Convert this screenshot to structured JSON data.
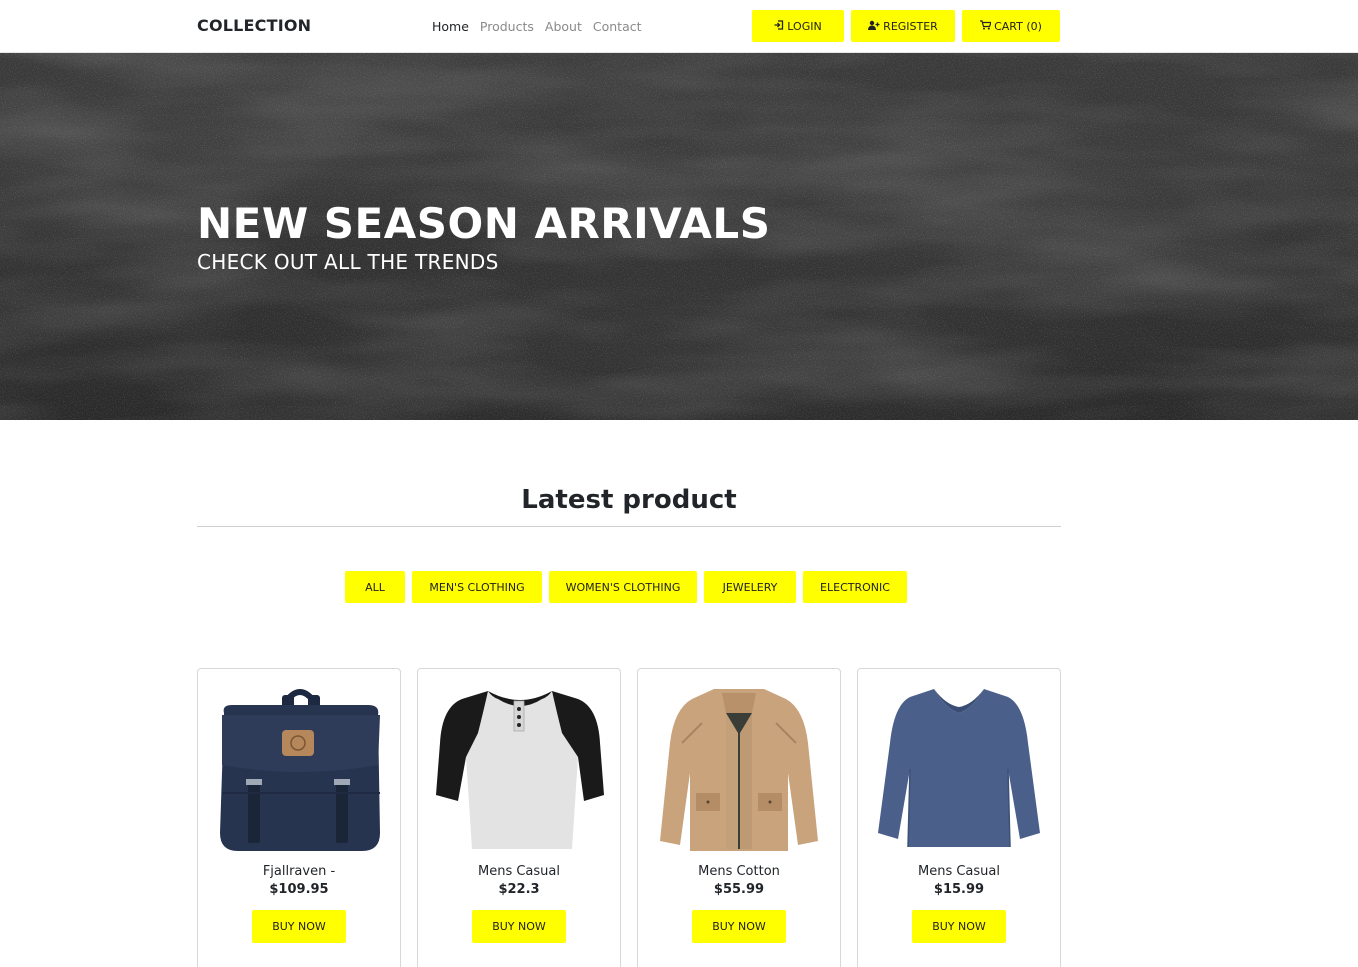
{
  "navbar": {
    "brand": "COLLECTION",
    "links": [
      {
        "label": "Home",
        "active": true
      },
      {
        "label": "Products",
        "active": false
      },
      {
        "label": "About",
        "active": false
      },
      {
        "label": "Contact",
        "active": false
      }
    ],
    "login_label": "LOGIN",
    "register_label": "REGISTER",
    "cart_label": "CART (0)",
    "accent_color": "#ffff00"
  },
  "hero": {
    "title": "NEW SEASON ARRIVALS",
    "subtitle": "CHECK OUT ALL THE TRENDS"
  },
  "latest": {
    "title": "Latest product",
    "filters": [
      "ALL",
      "MEN'S CLOTHING",
      "WOMEN'S CLOTHING",
      "JEWELERY",
      "ELECTRONIC"
    ]
  },
  "products": [
    {
      "name": "Fjallraven -",
      "price": "$109.95",
      "button": "BUY NOW",
      "image": "backpack"
    },
    {
      "name": "Mens Casual",
      "price": "$22.3",
      "button": "BUY NOW",
      "image": "raglan-tshirt"
    },
    {
      "name": "Mens Cotton",
      "price": "$55.99",
      "button": "BUY NOW",
      "image": "cotton-jacket"
    },
    {
      "name": "Mens Casual",
      "price": "$15.99",
      "button": "BUY NOW",
      "image": "slim-fit-tshirt"
    }
  ]
}
